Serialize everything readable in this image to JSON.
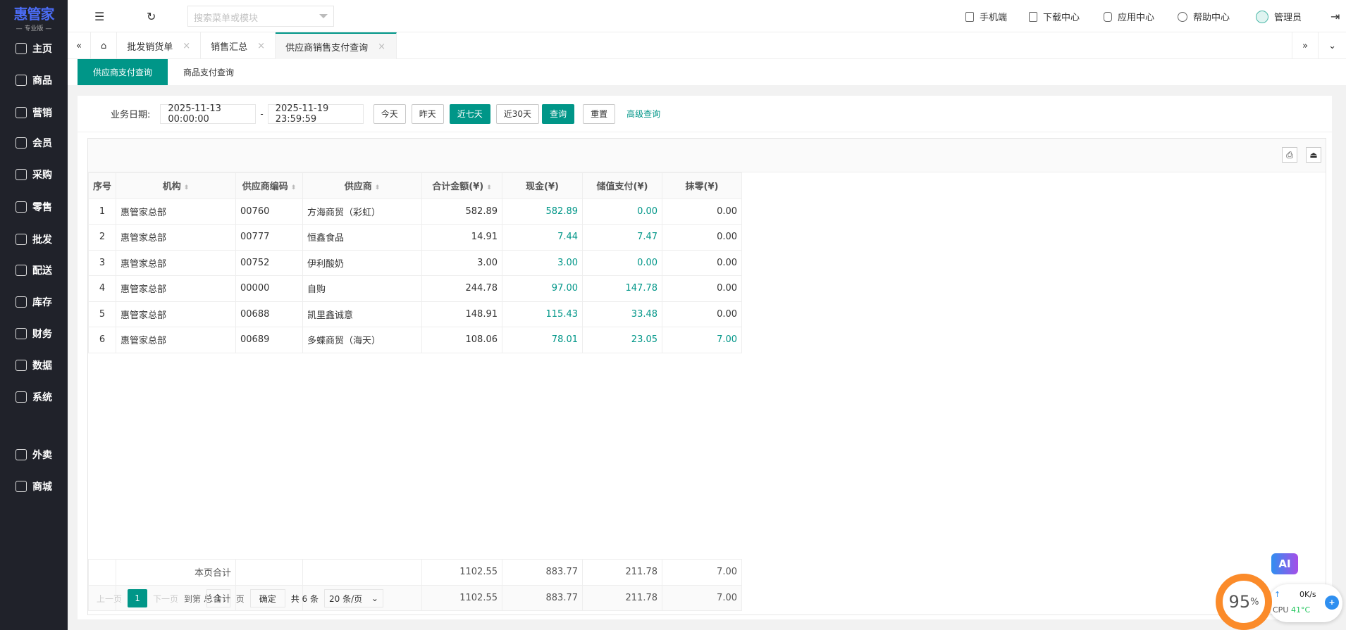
{
  "logo": {
    "name": "惠管家",
    "edition": "— 专业版 —"
  },
  "sidebar": {
    "items": [
      {
        "label": "主页",
        "icon": "home-icon"
      },
      {
        "label": "商品",
        "icon": "box-icon"
      },
      {
        "label": "营销",
        "icon": "chart-icon"
      },
      {
        "label": "会员",
        "icon": "member-icon"
      },
      {
        "label": "采购",
        "icon": "cart-icon"
      },
      {
        "label": "零售",
        "icon": "bag-icon"
      },
      {
        "label": "批发",
        "icon": "building-icon"
      },
      {
        "label": "配送",
        "icon": "delivery-icon"
      },
      {
        "label": "库存",
        "icon": "warehouse-icon"
      },
      {
        "label": "财务",
        "icon": "finance-icon"
      },
      {
        "label": "数据",
        "icon": "data-icon"
      },
      {
        "label": "系统",
        "icon": "settings-icon"
      },
      {
        "label": "外卖",
        "icon": "bike-icon"
      },
      {
        "label": "商城",
        "icon": "store-icon"
      }
    ]
  },
  "header": {
    "search_placeholder": "搜索菜单或模块",
    "mobile": "手机端",
    "download": "下载中心",
    "apps": "应用中心",
    "help": "帮助中心",
    "user": "管理员"
  },
  "tabs": [
    {
      "label": "批发销货单"
    },
    {
      "label": "销售汇总"
    },
    {
      "label": "供应商销售支付查询",
      "active": true
    }
  ],
  "subtabs": [
    {
      "label": "供应商支付查询",
      "active": true
    },
    {
      "label": "商品支付查询"
    }
  ],
  "filter": {
    "label": "业务日期:",
    "start": "2025-11-13 00:00:00",
    "sep": "-",
    "end": "2025-11-19 23:59:59",
    "today": "今天",
    "yesterday": "昨天",
    "last7": "近七天",
    "last30": "近30天",
    "query": "查询",
    "reset": "重置",
    "advanced": "高级查询"
  },
  "table": {
    "columns": [
      "序号",
      "机构",
      "供应商编码",
      "供应商",
      "合计金额(¥)",
      "现金(¥)",
      "储值支付(¥)",
      "抹零(¥)"
    ],
    "rows": [
      [
        "1",
        "惠管家总部",
        "00760",
        "方海商贸（彩虹）",
        "582.89",
        "582.89",
        "0.00",
        "0.00"
      ],
      [
        "2",
        "惠管家总部",
        "00777",
        "恒鑫食品",
        "14.91",
        "7.44",
        "7.47",
        "0.00"
      ],
      [
        "3",
        "惠管家总部",
        "00752",
        "伊利酸奶",
        "3.00",
        "3.00",
        "0.00",
        "0.00"
      ],
      [
        "4",
        "惠管家总部",
        "00000",
        "自购",
        "244.78",
        "97.00",
        "147.78",
        "0.00"
      ],
      [
        "5",
        "惠管家总部",
        "00688",
        "凯里鑫诚意",
        "148.91",
        "115.43",
        "33.48",
        "0.00"
      ],
      [
        "6",
        "惠管家总部",
        "00689",
        "多蝶商贸（海天）",
        "108.06",
        "78.01",
        "23.05",
        "7.00"
      ]
    ],
    "page_total": {
      "label": "本页合计",
      "values": [
        "1102.55",
        "883.77",
        "211.78",
        "7.00"
      ]
    },
    "grand_total": {
      "label": "总合计",
      "values": [
        "1102.55",
        "883.77",
        "211.78",
        "7.00"
      ]
    }
  },
  "pager": {
    "prev": "上一页",
    "current": "1",
    "next": "下一页",
    "goto": "到第",
    "page_input": "1",
    "page_unit": "页",
    "confirm": "确定",
    "total": "共 6 条",
    "page_size": "20 条/页"
  },
  "widget": {
    "ai": "AI",
    "percent": "95",
    "percent_unit": "%",
    "speed": "0K/s",
    "cpu_label": "CPU",
    "cpu_temp": "41°C"
  },
  "colors": {
    "accent": "#009688",
    "sidebar": "#20222a"
  }
}
